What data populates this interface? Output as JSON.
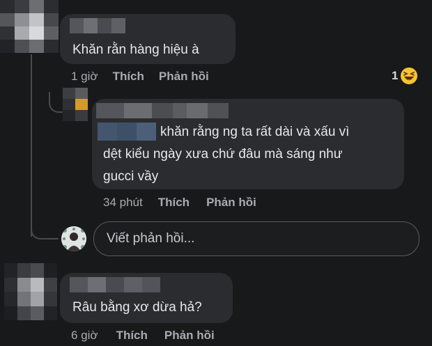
{
  "comments": [
    {
      "text": "Khăn rằn hàng hiệu à",
      "time": "1 giờ",
      "like_label": "Thích",
      "reply_label": "Phản hồi",
      "reaction_count": "1",
      "reaction_icon": "haha-emoji-icon"
    },
    {
      "text_line1": "khăn rằng ng ta rất dài và xấu vì",
      "text_line2": "dệt kiểu ngày xưa chứ đâu mà sáng như",
      "text_line3": "gucci vầy",
      "time": "34 phút",
      "like_label": "Thích",
      "reply_label": "Phản hồi"
    },
    {
      "text": "Râu bằng xơ dừa hả?",
      "time": "6 giờ",
      "like_label": "Thích",
      "reply_label": "Phản hồi"
    }
  ],
  "reply_input": {
    "placeholder": "Viết phản hồi..."
  },
  "colors": {
    "background": "#18191b",
    "bubble": "#2b2c30",
    "meta_text": "#a9abb0",
    "reaction_yellow": "#f7c531"
  }
}
